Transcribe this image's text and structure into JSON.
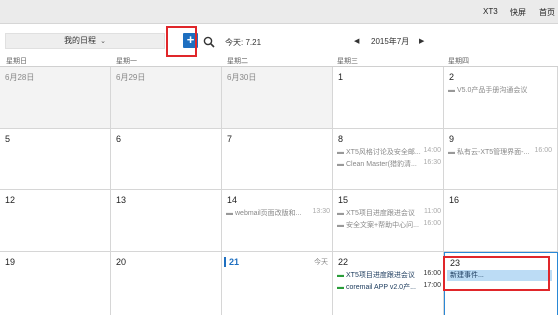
{
  "topbar": {
    "links": [
      "XT3",
      "快屏",
      "首页"
    ]
  },
  "toolbar": {
    "calendar_select": "我的日程",
    "add_label": "+",
    "today_label": "今天: 7.21",
    "month_label": "2015年7月"
  },
  "weekdays": [
    "星期日",
    "星期一",
    "星期二",
    "星期三",
    "星期四"
  ],
  "weeks": [
    {
      "days": [
        {
          "num": "6月28日",
          "prev": true,
          "events": []
        },
        {
          "num": "6月29日",
          "prev": true,
          "events": []
        },
        {
          "num": "6月30日",
          "prev": true,
          "events": []
        },
        {
          "num": "1",
          "events": []
        },
        {
          "num": "2",
          "events": [
            {
              "title": "V5.0产品手册沟通会议",
              "time": ""
            }
          ]
        }
      ]
    },
    {
      "days": [
        {
          "num": "5",
          "events": []
        },
        {
          "num": "6",
          "events": []
        },
        {
          "num": "7",
          "events": []
        },
        {
          "num": "8",
          "events": [
            {
              "title": "XT5风格讨论及安全邮...",
              "time": "14:00"
            },
            {
              "title": "Clean Master(猎豹清...",
              "time": "16:30"
            }
          ]
        },
        {
          "num": "9",
          "events": [
            {
              "title": "私有云-XT5管理界面-...",
              "time": "16:00"
            }
          ]
        }
      ]
    },
    {
      "days": [
        {
          "num": "12",
          "events": []
        },
        {
          "num": "13",
          "events": []
        },
        {
          "num": "14",
          "events": [
            {
              "title": "webmail页面改版和...",
              "time": "13:30"
            }
          ]
        },
        {
          "num": "15",
          "events": [
            {
              "title": "XT5项目进度跟进会议",
              "time": "11:00"
            },
            {
              "title": "安全文案+帮助中心问...",
              "time": "16:00"
            }
          ]
        },
        {
          "num": "16",
          "events": []
        }
      ]
    },
    {
      "days": [
        {
          "num": "19",
          "events": []
        },
        {
          "num": "20",
          "events": []
        },
        {
          "num": "21",
          "today": true,
          "today_tag": "今天",
          "events": []
        },
        {
          "num": "22",
          "events": [
            {
              "title": "XT5项目进度跟进会议",
              "time": "16:00",
              "active": true
            },
            {
              "title": "coremail APP v2.0产...",
              "time": "17:00",
              "active": true
            }
          ]
        },
        {
          "num": "23",
          "selected": true,
          "new_event": "新建事件...",
          "events": []
        }
      ]
    }
  ],
  "colors": {
    "accent": "#1e6fc0",
    "highlight": "#e0262a",
    "new_event_bg": "#bcdcf5"
  }
}
